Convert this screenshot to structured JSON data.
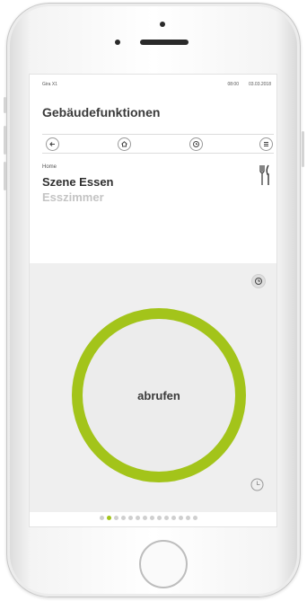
{
  "status_bar": {
    "device_name": "Gira X1",
    "time": "08:00",
    "date": "03.03.2018"
  },
  "header": {
    "title": "Gebäudefunktionen"
  },
  "toolbar": {
    "back_icon": "back-arrow-icon",
    "home_icon": "home-icon",
    "timer_icon": "clock-icon",
    "menu_icon": "menu-icon"
  },
  "scene": {
    "breadcrumb": "Home",
    "name": "Szene Essen",
    "room": "Esszimmer",
    "category_icon": "fork-knife-icon"
  },
  "action": {
    "label": "abrufen",
    "ring_color": "#a3c41a"
  },
  "pager": {
    "count": 14,
    "active_index": 1
  }
}
